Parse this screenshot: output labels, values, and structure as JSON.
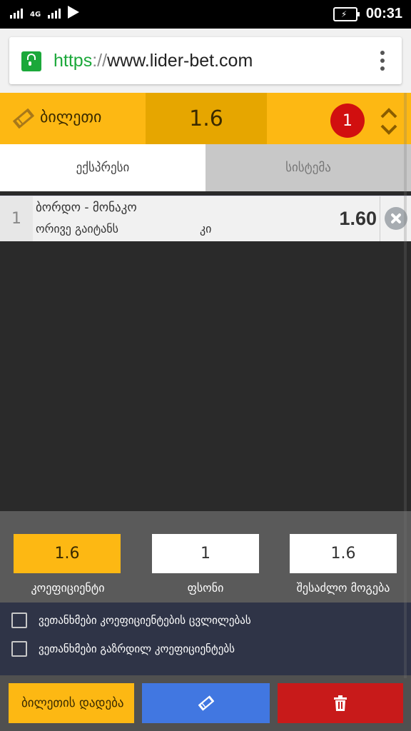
{
  "status_bar": {
    "network": "4G",
    "time": "00:31"
  },
  "browser": {
    "url_scheme": "https",
    "url_sep": "://",
    "url_host": "www.lider-bet.com"
  },
  "ticket": {
    "title": "ბილეთი",
    "total_odds": "1.6",
    "count": "1"
  },
  "tabs": [
    {
      "label": "ექსპრესი",
      "active": true
    },
    {
      "label": "სისტემა",
      "active": false
    }
  ],
  "bets": [
    {
      "number": "1",
      "match": "ბორდო - მონაკო",
      "market": "ორივე გაიტანს",
      "outcome": "კი",
      "odds": "1.60"
    }
  ],
  "calculator": {
    "odds_value": "1.6",
    "odds_label": "კოეფიციენტი",
    "stake_value": "1",
    "stake_label": "ფსონი",
    "win_value": "1.6",
    "win_label": "შესაძლო მოგება"
  },
  "agreements": [
    {
      "label": "ვეთანხმები კოეფიციენტების ცვლილებას",
      "checked": false
    },
    {
      "label": "ვეთანხმები გაზრდილ კოეფიციენტებს",
      "checked": false
    }
  ],
  "actions": {
    "place_label": "ბილეთის დადება"
  },
  "colors": {
    "accent": "#fdb813",
    "accent_dark": "#e6a600",
    "primary_blue": "#4177e1",
    "danger_red": "#c81a1a",
    "secure_green": "#1ba83a"
  },
  "icons": {
    "ticket": "ticket-icon",
    "expand": "expand-collapse-icon",
    "remove": "close-circle-icon",
    "delete": "trash-icon",
    "lock": "lock-icon",
    "menu": "more-vert-icon"
  }
}
